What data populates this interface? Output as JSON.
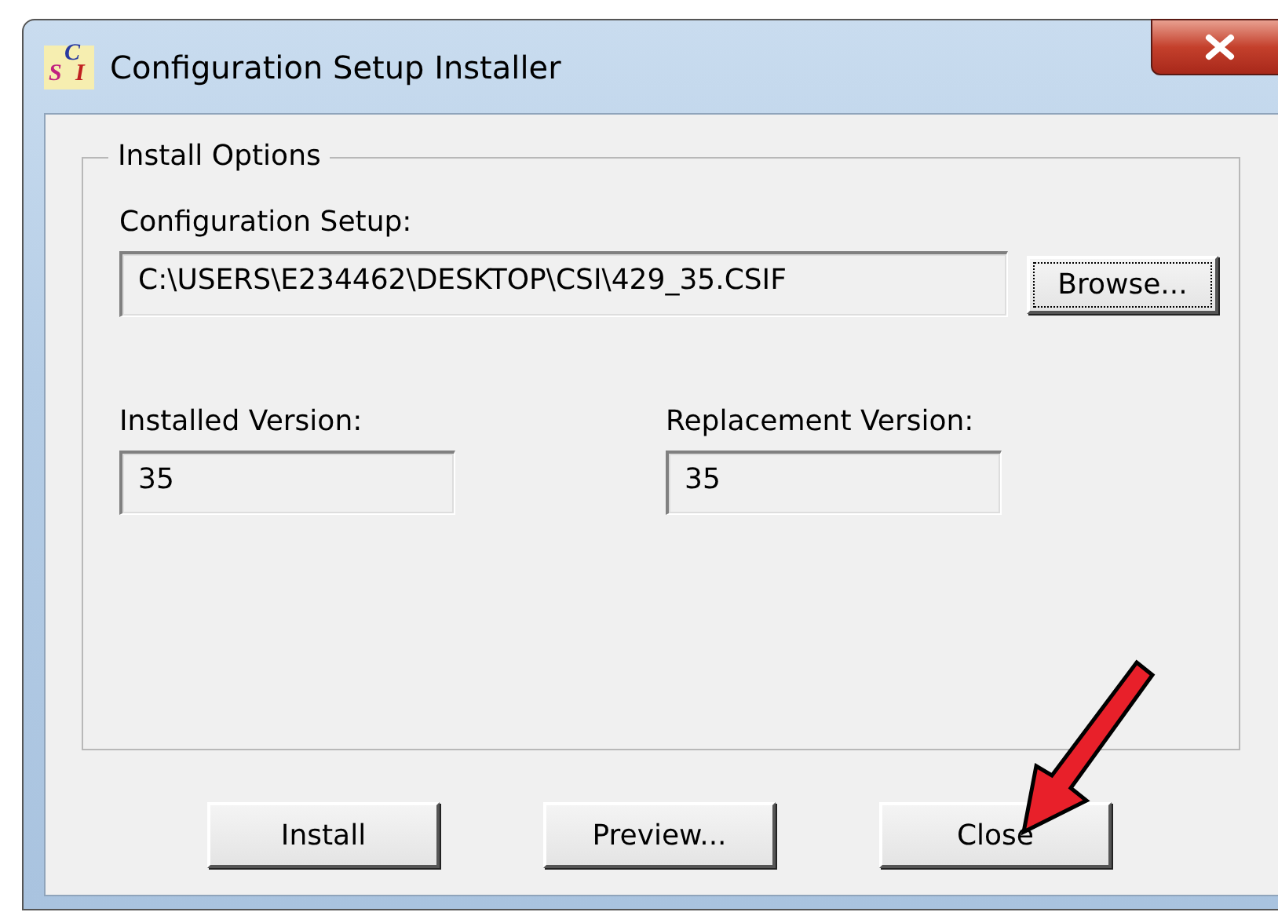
{
  "window": {
    "title": "Configuration Setup Installer",
    "icon_letters": [
      "C",
      "S",
      "I"
    ]
  },
  "group": {
    "title": "Install Options",
    "config": {
      "label": "Configuration Setup:",
      "value": "C:\\USERS\\E234462\\DESKTOP\\CSI\\429_35.CSIF",
      "browse": "Browse..."
    },
    "installed": {
      "label": "Installed Version:",
      "value": "35"
    },
    "replacement": {
      "label": "Replacement Version:",
      "value": "35"
    }
  },
  "buttons": [
    "Install",
    "Preview...",
    "Close"
  ]
}
